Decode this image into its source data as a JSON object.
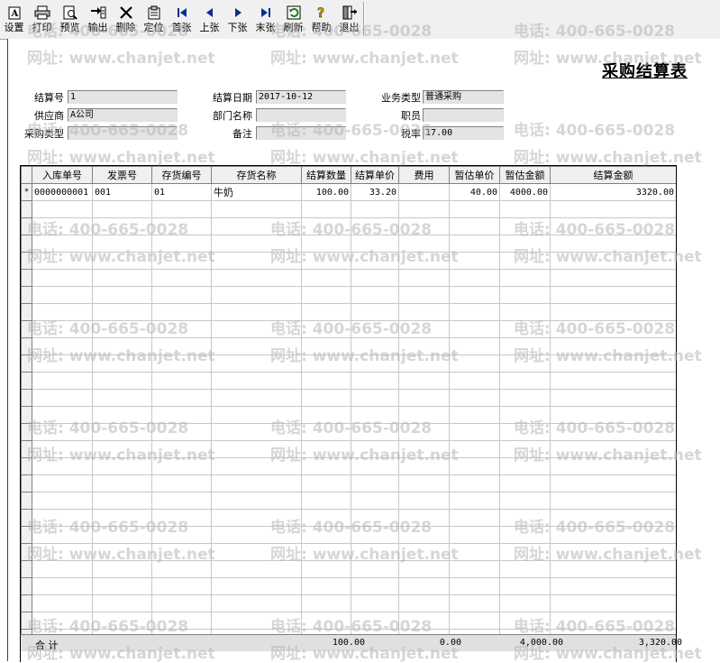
{
  "toolbar": {
    "buttons": [
      {
        "label": "设置",
        "icon": "settings-icon"
      },
      {
        "label": "打印",
        "icon": "printer-icon"
      },
      {
        "label": "预览",
        "icon": "preview-icon"
      },
      {
        "label": "输出",
        "icon": "export-icon"
      },
      {
        "label": "删除",
        "icon": "delete-icon"
      },
      {
        "label": "定位",
        "icon": "locate-icon"
      },
      {
        "label": "首张",
        "icon": "first-record-icon"
      },
      {
        "label": "上张",
        "icon": "prev-record-icon"
      },
      {
        "label": "下张",
        "icon": "next-record-icon"
      },
      {
        "label": "末张",
        "icon": "last-record-icon"
      },
      {
        "label": "刷新",
        "icon": "refresh-icon"
      },
      {
        "label": "帮助",
        "icon": "help-icon"
      },
      {
        "label": "退出",
        "icon": "exit-icon"
      }
    ]
  },
  "form": {
    "title": "采购结算表",
    "settlement_no_label": "结算号",
    "settlement_no": "1",
    "settlement_date_label": "结算日期",
    "settlement_date": "2017-10-12",
    "business_type_label": "业务类型",
    "business_type": "普通采购",
    "supplier_label": "供应商",
    "supplier": "A公司",
    "department_label": "部门名称",
    "department": "",
    "staff_label": "职员",
    "staff": "",
    "purchase_type_label": "采购类型",
    "purchase_type": "",
    "remark_label": "备注",
    "remark": "",
    "tax_rate_label": "税率",
    "tax_rate": "17.00"
  },
  "grid": {
    "columns": [
      "入库单号",
      "发票号",
      "存货编号",
      "存货名称",
      "结算数量",
      "结算单价",
      "费用",
      "暂估单价",
      "暂估金额",
      "结算金额"
    ],
    "rows": [
      {
        "marker": "*",
        "cells": [
          "0000000001",
          "001",
          "01",
          "牛奶",
          "100.00",
          "33.20",
          "",
          "40.00",
          "4000.00",
          "3320.00"
        ]
      }
    ],
    "totals": {
      "label": "合 计",
      "quantity": "100.00",
      "fee": "0.00",
      "estimated_amount": "4,000.00",
      "settlement_amount": "3,320.00"
    }
  },
  "watermark": {
    "phone": "电话: 400-665-0028",
    "site": "网址: www.chanjet.net"
  }
}
